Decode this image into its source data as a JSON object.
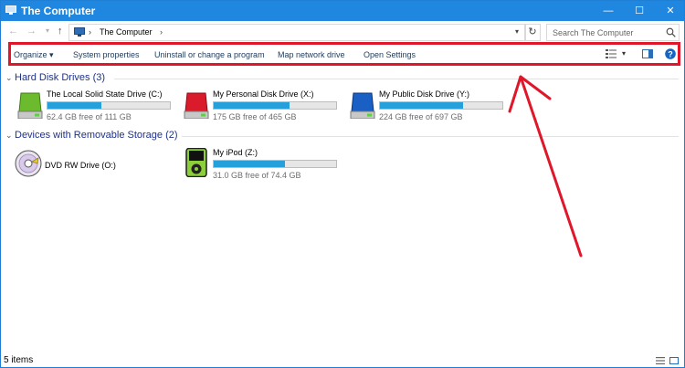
{
  "window": {
    "title": "The Computer"
  },
  "titlebar_buttons": {
    "minimize": "—",
    "maximize": "☐",
    "close": "✕"
  },
  "nav": {
    "back": "←",
    "forward": "→",
    "recent": "▾",
    "up": "↑"
  },
  "address": {
    "separator": "›",
    "crumb": "The Computer",
    "dropdown": "▾",
    "refresh": "↻"
  },
  "search": {
    "placeholder": "Search The Computer"
  },
  "toolbar": {
    "organize": "Organize",
    "organize_arrow": "▾",
    "system_properties": "System properties",
    "uninstall": "Uninstall or change a program",
    "map_network_drive": "Map network drive",
    "open_settings": "Open Settings",
    "view_dropdown": "▾"
  },
  "groups": [
    {
      "title": "Hard Disk Drives (3)",
      "items": [
        {
          "name": "The Local Solid State Drive (C:)",
          "free": "62.4 GB free of 111 GB",
          "used_fraction": 0.44,
          "icon": "hard-drive-green-icon"
        },
        {
          "name": "My Personal Disk Drive (X:)",
          "free": "175 GB free of 465 GB",
          "used_fraction": 0.62,
          "icon": "hard-drive-red-icon"
        },
        {
          "name": "My Public Disk Drive (Y:)",
          "free": "224 GB free of 697 GB",
          "used_fraction": 0.68,
          "icon": "hard-drive-blue-icon"
        }
      ]
    },
    {
      "title": "Devices with Removable Storage (2)",
      "items": [
        {
          "name": "DVD RW Drive (O:)",
          "icon": "dvd-drive-icon"
        },
        {
          "name": "My iPod (Z:)",
          "free": "31.0 GB free of 74.4 GB",
          "used_fraction": 0.58,
          "icon": "ipod-icon"
        }
      ]
    }
  ],
  "status": {
    "count": "5 items"
  },
  "colors": {
    "titlebar": "#1f87e0",
    "highlight": "#e0172a",
    "bar_fill": "#26a0da",
    "group_header": "#1e3287"
  }
}
